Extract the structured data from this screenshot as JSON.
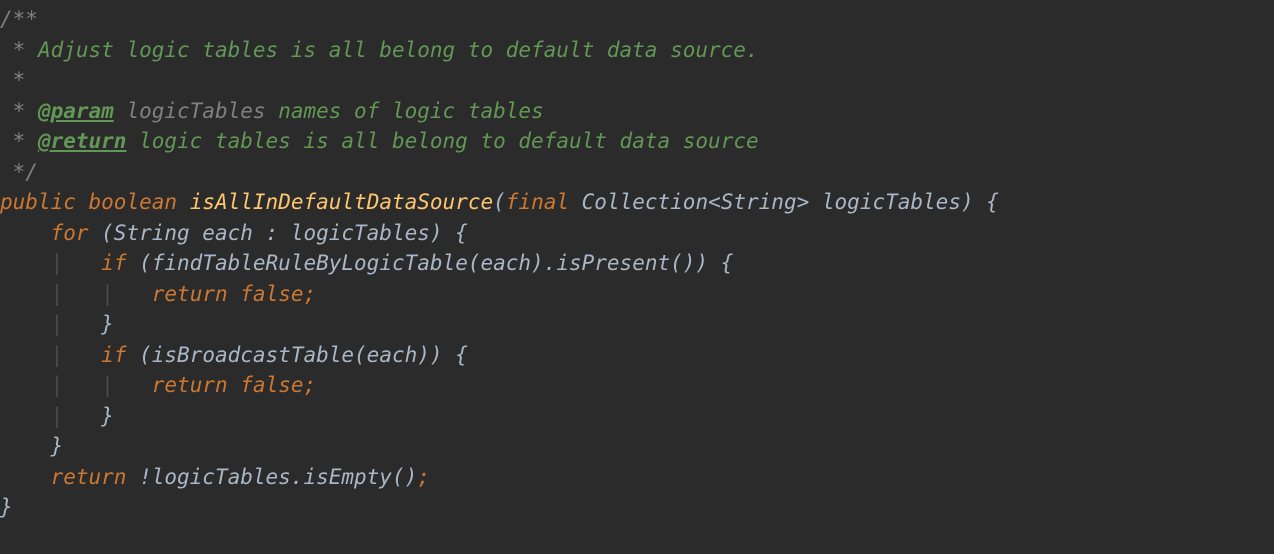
{
  "colors": {
    "background": "#2b2b2b",
    "comment_gray": "#808080",
    "doc_green": "#629755",
    "default_text": "#a9b7c6",
    "keyword_orange": "#cc7832",
    "method_yellow": "#ffc66d",
    "indent_guide": "#4b4b4b"
  },
  "code": {
    "javadoc": {
      "open": "/**",
      "summary": "Adjust logic tables is all belong to default data source.",
      "param_tag": "@param",
      "param_name": "logicTables",
      "param_desc": "names of logic tables",
      "return_tag": "@return",
      "return_desc": "logic tables is all belong to default data source",
      "close": "*/"
    },
    "signature": {
      "public": "public",
      "boolean": "boolean",
      "method": "isAllInDefaultDataSource",
      "open_paren": "(",
      "final": "final",
      "collection": "Collection<String>",
      "param": "logicTables",
      "close": ") {"
    },
    "l8": {
      "for": "for",
      "rest": " (String each : logicTables) {"
    },
    "l9": {
      "if": "if",
      "rest": " (findTableRuleByLogicTable(each).isPresent()) {"
    },
    "l10": {
      "return": "return",
      "false": "false",
      "semi": ";"
    },
    "l11": {
      "brace": "}"
    },
    "l12": {
      "if": "if",
      "rest": " (isBroadcastTable(each)) {"
    },
    "l13": {
      "return": "return",
      "false": "false",
      "semi": ";"
    },
    "l14": {
      "brace": "}"
    },
    "l15": {
      "brace": "}"
    },
    "l16": {
      "return": "return",
      "rest": " !logicTables.isEmpty()",
      "semi": ";"
    },
    "l17": {
      "brace": "}"
    }
  }
}
